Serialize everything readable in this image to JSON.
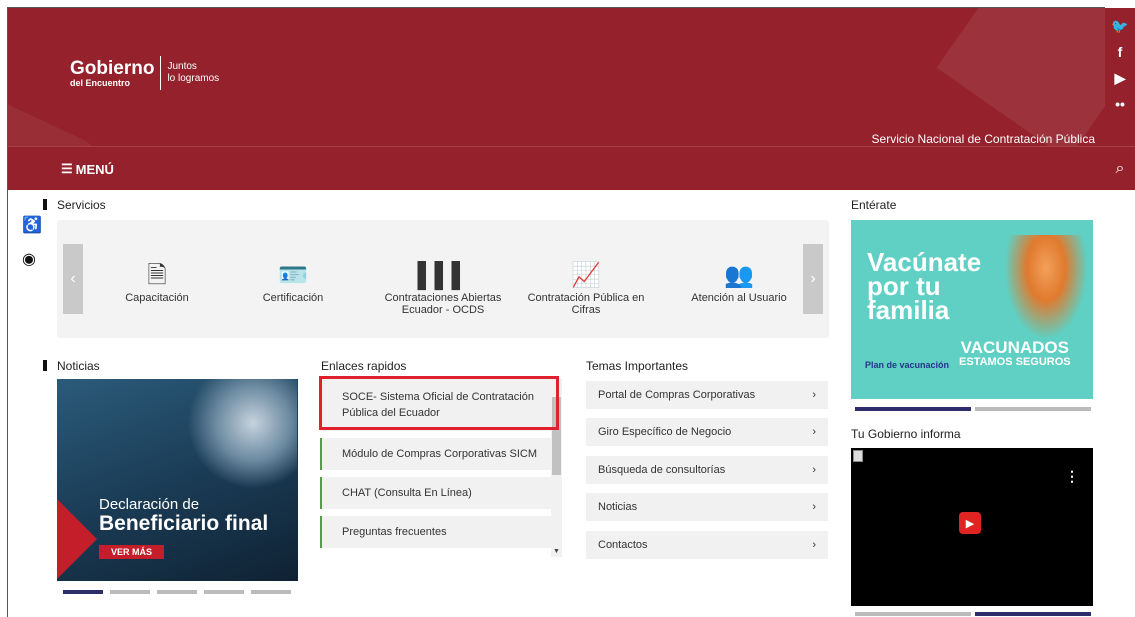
{
  "header": {
    "logo_main": "Gobierno",
    "logo_sub": "del Encuentro",
    "logo_tag_1": "Juntos",
    "logo_tag_2": "lo logramos",
    "institution": "Servicio Nacional de Contratación Pública"
  },
  "menu": {
    "label": "MENÚ"
  },
  "social": [
    "twitter-icon",
    "facebook-icon",
    "youtube-icon",
    "flickr-icon"
  ],
  "sections": {
    "servicios": "Servicios",
    "noticias": "Noticias",
    "enlaces": "Enlaces rapidos",
    "temas": "Temas Importantes",
    "enterate": "Entérate",
    "tu_gobierno": "Tu Gobierno informa"
  },
  "services": [
    {
      "label": "Capacitación",
      "icon": "document-icon"
    },
    {
      "label": "Certificación",
      "icon": "id-card-icon"
    },
    {
      "label": "Contrataciones Abiertas Ecuador - OCDS",
      "icon": "bar-chart-icon"
    },
    {
      "label": "Contratación Pública en Cifras",
      "icon": "line-chart-icon"
    },
    {
      "label": "Atención al Usuario",
      "icon": "users-icon"
    }
  ],
  "news": {
    "title_1": "Declaración de",
    "title_2": "Beneficiario final",
    "button": "VER MÁS"
  },
  "quick_links": [
    "SOCE- Sistema Oficial de Contratación Pública del Ecuador",
    "Módulo de Compras Corporativas SICM",
    "CHAT (Consulta En Línea)",
    "Preguntas frecuentes"
  ],
  "topics": [
    "Portal de Compras Corporativas",
    "Giro Específico de Negocio",
    "Búsqueda de consultorías",
    "Noticias",
    "Contactos"
  ],
  "ad": {
    "headline": "Vacúnate por tu familia",
    "slogan_1": "VACUNADOS",
    "slogan_2": "ESTAMOS SEGUROS",
    "plan": "Plan de vacunación"
  },
  "colors": {
    "brand": "#94212b",
    "highlight": "#e0202c",
    "indicator": "#2e2d6b"
  }
}
